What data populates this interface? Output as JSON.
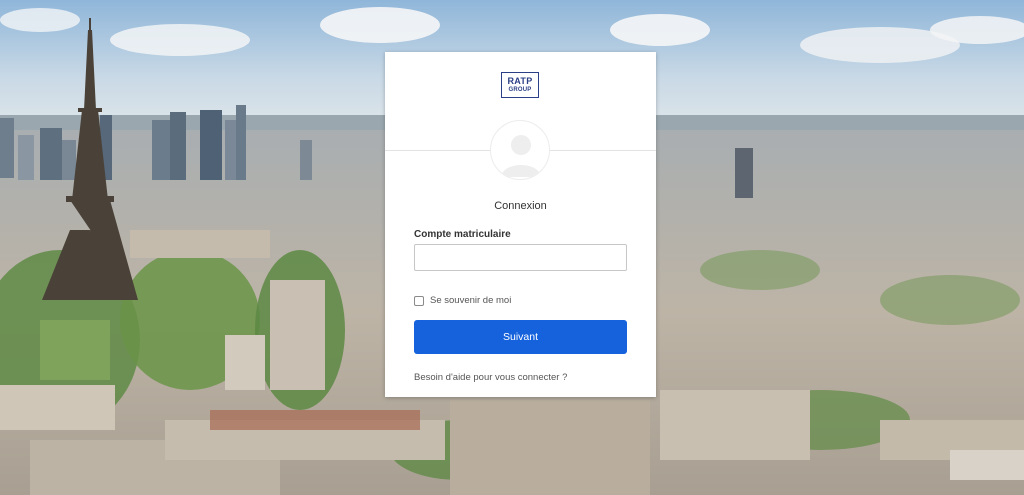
{
  "logo": {
    "line1": "RATP",
    "line2": "GROUP",
    "color": "#2b3f86"
  },
  "form": {
    "title": "Connexion",
    "field_label": "Compte matriculaire",
    "field_value": "",
    "remember_label": "Se souvenir de moi",
    "remember_checked": false,
    "submit_label": "Suivant",
    "help_link": "Besoin d'aide pour vous connecter ?"
  },
  "colors": {
    "primary_button": "#1662dd",
    "card_background": "#ffffff"
  },
  "icons": {
    "avatar": "user-avatar-icon"
  }
}
